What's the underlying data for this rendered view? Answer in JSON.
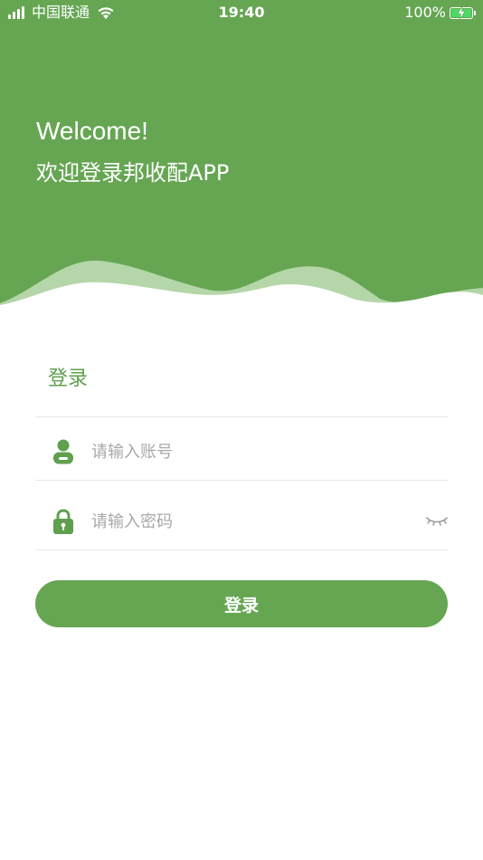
{
  "status_bar": {
    "carrier": "中国联通",
    "time": "19:40",
    "battery_percent": "100%",
    "signal_icon": "signal-bars-icon",
    "wifi_icon": "wifi-icon",
    "battery_icon": "battery-charging-icon"
  },
  "header": {
    "welcome": "Welcome!",
    "subtitle": "欢迎登录邦收配APP"
  },
  "form": {
    "title": "登录",
    "account": {
      "icon": "user-icon",
      "placeholder": "请输入账号",
      "value": ""
    },
    "password": {
      "icon": "lock-icon",
      "placeholder": "请输入密码",
      "value": "",
      "toggle_icon": "eye-closed-icon"
    },
    "submit_label": "登录"
  },
  "colors": {
    "brand_green": "#66a653",
    "title_green": "#5f9f4e",
    "placeholder_gray": "#a8a8a8",
    "divider": "#e8e8e8"
  }
}
